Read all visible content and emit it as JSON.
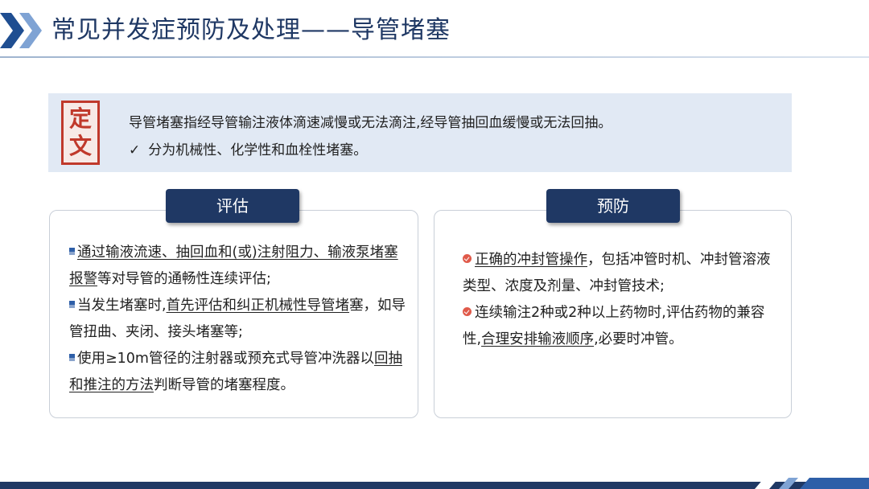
{
  "header": {
    "title": "常见并发症预防及处理——导管堵塞"
  },
  "definition": {
    "seal_chars": [
      "定",
      "文"
    ],
    "line1": "导管堵塞指经导管输注液体滴速减慢或无法滴注,经导管抽回血缓慢或无法回抽。",
    "line2_check": "✓",
    "line2": "分为机械性、化学性和血栓性堵塞。"
  },
  "assessment": {
    "tag": "评估",
    "items": [
      {
        "segments": [
          {
            "text": "通过输液流速、抽回血和(或)注射阻力、输液泵堵塞报警",
            "u": true
          },
          {
            "text": "等对导管的通畅性连续评估;",
            "u": false
          }
        ]
      },
      {
        "segments": [
          {
            "text": "当发生堵塞时,",
            "u": false
          },
          {
            "text": "首先评估和纠正机械性导管堵",
            "u": true
          },
          {
            "text": "塞，如导管扭曲、夹闭、接头堵塞等;",
            "u": false
          }
        ]
      },
      {
        "segments": [
          {
            "text": "使用≥10m管径的注射器或预充式导管冲洗器以",
            "u": false
          },
          {
            "text": "回抽和推注的方法",
            "u": true
          },
          {
            "text": "判断导管的堵塞程度。",
            "u": false
          }
        ]
      }
    ]
  },
  "prevention": {
    "tag": "预防",
    "items": [
      {
        "segments": [
          {
            "text": "正确的冲封管操作",
            "u": true
          },
          {
            "text": "，包括冲管时机、冲封管溶液类型、浓度及剂量、冲封管技术;",
            "u": false
          }
        ]
      },
      {
        "segments": [
          {
            "text": "连续输注2种或2种以上药物时,评估药物的兼容性,",
            "u": false
          },
          {
            "text": "合理安排输液顺序",
            "u": true
          },
          {
            "text": ",必要时冲管。",
            "u": false
          }
        ]
      }
    ]
  },
  "colors": {
    "navy": "#1f3864",
    "definition_bg": "#e1e9f4",
    "seal_red": "#c0392b",
    "accent_blue": "#2e5fa8",
    "bullet_red": "#e05a4a"
  }
}
